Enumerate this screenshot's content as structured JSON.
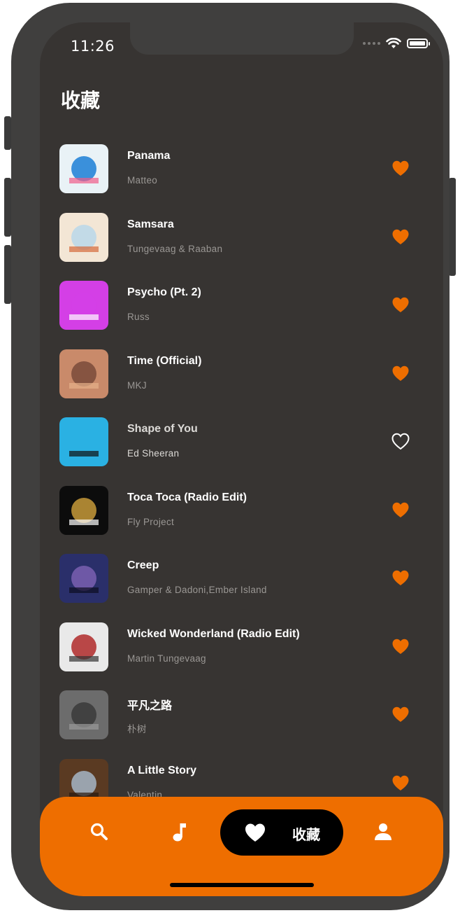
{
  "status_bar": {
    "time": "11:26"
  },
  "page": {
    "title": "收藏"
  },
  "songs": [
    {
      "title": "Panama",
      "artist": "Matteo",
      "liked": true,
      "cover_colors": [
        "#e9f2f6",
        "#1b7fd6",
        "#f05c8a"
      ]
    },
    {
      "title": "Samsara",
      "artist": "Tungevaag & Raaban",
      "liked": true,
      "cover_colors": [
        "#f3e6d5",
        "#b8d7ea",
        "#d4693b"
      ]
    },
    {
      "title": "Psycho (Pt. 2)",
      "artist": "Russ",
      "liked": true,
      "cover_colors": [
        "#d43fe6",
        "#d43fe6",
        "#ffffff"
      ]
    },
    {
      "title": "Time (Official)",
      "artist": "MKJ",
      "liked": true,
      "cover_colors": [
        "#c98a6a",
        "#7a4a3a",
        "#e6b08a"
      ]
    },
    {
      "title": "Shape of You",
      "artist": "Ed Sheeran",
      "liked": false,
      "cover_colors": [
        "#2ab1e3",
        "#2ab1e3",
        "#111111"
      ]
    },
    {
      "title": "Toca Toca (Radio Edit)",
      "artist": "Fly Project",
      "liked": true,
      "cover_colors": [
        "#0c0c0c",
        "#c79a3a",
        "#ffffff"
      ]
    },
    {
      "title": "Creep",
      "artist": "Gamper & Dadoni,Ember Island",
      "liked": true,
      "cover_colors": [
        "#2a2f6a",
        "#7a5fb0",
        "#0d0d22"
      ]
    },
    {
      "title": "Wicked Wonderland (Radio Edit)",
      "artist": "Martin Tungevaag",
      "liked": true,
      "cover_colors": [
        "#e9e9e9",
        "#b02a2a",
        "#333333"
      ]
    },
    {
      "title": "平凡之路",
      "artist": "朴树",
      "liked": true,
      "cover_colors": [
        "#6c6c6c",
        "#3a3a3a",
        "#9a9a9a"
      ]
    },
    {
      "title": "A Little Story",
      "artist": "Valentin",
      "liked": true,
      "cover_colors": [
        "#5a3a22",
        "#a6b6c6",
        "#2a1a10"
      ]
    }
  ],
  "tabbar": {
    "items": [
      {
        "name": "search",
        "icon": "search-icon"
      },
      {
        "name": "music",
        "icon": "music-note-icon"
      },
      {
        "name": "favorites",
        "icon": "heart-icon",
        "label": "收藏",
        "active": true
      },
      {
        "name": "profile",
        "icon": "person-icon"
      }
    ]
  },
  "colors": {
    "accent": "#ee6e00",
    "background": "#373432",
    "active_tab_bg": "#000000"
  }
}
